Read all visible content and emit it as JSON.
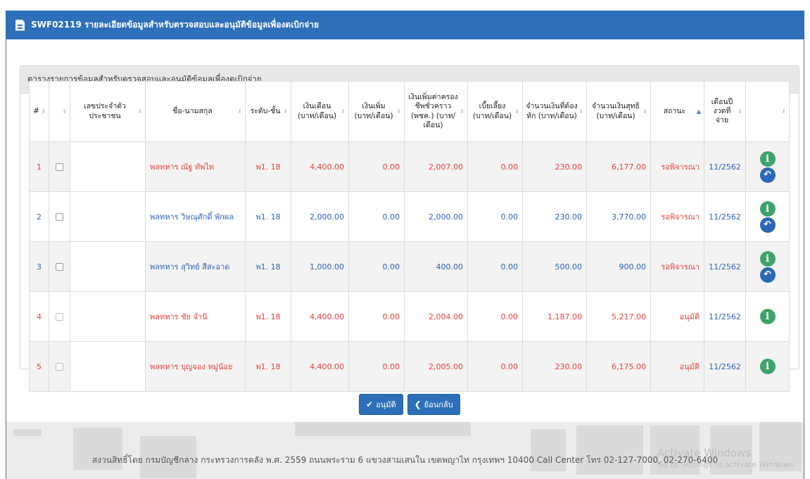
{
  "title": "SWF02119 รายละเอียดข้อมูลสำหรับตรวจสอบและอนุมัติข้อมูลเพื่องดเบิกจ่าย",
  "panel_title": "ตารางรายการข้อมูลสำหรับตรวจสอบและอนุมัติข้อมูลเพื่องดเบิกจ่าย",
  "columns": [
    "#",
    "",
    "เลขประจำตัวประชาชน",
    "ชื่อ-นามสกุล",
    "ระดับ-ชั้น",
    "เงินเดือน (บาท/เดือน)",
    "เงินเพิ่ม (บาท/เดือน)",
    "เงินเพิ่มค่าครองชีพชั่วคราว (พชค.) (บาท/เดือน)",
    "เบี้ยเลี้ยง (บาท/เดือน)",
    "จำนวนเงินที่ต้องหัก (บาท/เดือน)",
    "จำนวนเงินสุทธิ (บาท/เดือน)",
    "สถานะ",
    "เดือนปีงวดที่จ่าย",
    ""
  ],
  "rows": [
    {
      "no": "1",
      "name": "พลทหาร ณัฐ ทัพไท",
      "level": "พ1. 18",
      "salary": "4,400.00",
      "extra": "0.00",
      "cola": "2,007.00",
      "allowance": "0.00",
      "deduct": "230.00",
      "net": "6,177.00",
      "status": "รอพิจารณา",
      "period": "11/2562"
    },
    {
      "no": "2",
      "name": "พลทหาร วิษณุศักดิ์ พักผล",
      "level": "พ1. 18",
      "salary": "2,000.00",
      "extra": "0.00",
      "cola": "2,000.00",
      "allowance": "0.00",
      "deduct": "230.00",
      "net": "3,770.00",
      "status": "รอพิจารณา",
      "period": "11/2562"
    },
    {
      "no": "3",
      "name": "พลทหาร สุวิทย์ สีสะอาด",
      "level": "พ1. 18",
      "salary": "1,000.00",
      "extra": "0.00",
      "cola": "400.00",
      "allowance": "0.00",
      "deduct": "500.00",
      "net": "900.00",
      "status": "รอพิจารณา",
      "period": "11/2562"
    },
    {
      "no": "4",
      "name": "พลทหาร ชัย จำนิ",
      "level": "พ1. 18",
      "salary": "4,400.00",
      "extra": "0.00",
      "cola": "2,004.00",
      "allowance": "0.00",
      "deduct": "1,187.00",
      "net": "5,217.00",
      "status": "อนุมัติ",
      "period": "11/2562"
    },
    {
      "no": "5",
      "name": "พลทหาร บุญจอง หมู่น้อย",
      "level": "พ1. 18",
      "salary": "4,400.00",
      "extra": "0.00",
      "cola": "2,005.00",
      "allowance": "0.00",
      "deduct": "230.00",
      "net": "6,175.00",
      "status": "อนุมัติ",
      "period": "11/2562"
    }
  ],
  "buttons": {
    "approve": "อนุมัติ",
    "back": "ย้อนกลับ"
  },
  "footer": "สงวนสิทธิ์โดย กรมบัญชีกลาง กระทรวงการคลัง พ.ศ. 2559 ถนนพระราม 6 แขวงสามเสนใน เขตพญาไท กรุงเทพฯ 10400 Call Center โทร 02-127-7000, 02-270-6400",
  "watermark": {
    "line1": "Activate Windows",
    "line2": "Go to Settings to activate Windows."
  },
  "colors": {
    "header_bar": "#2d6fb8",
    "pending_text": "#e8413c",
    "approved_text": "#2f63b8",
    "info_button": "#3da36b",
    "back_button": "#2a68b5"
  }
}
